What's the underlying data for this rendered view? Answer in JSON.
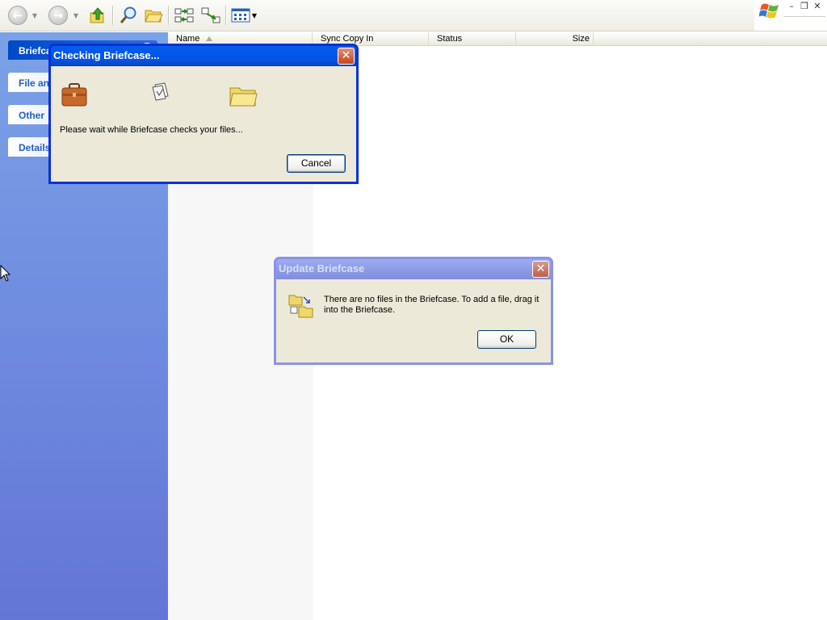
{
  "list": {
    "columns": [
      {
        "label": "Name"
      },
      {
        "label": "Sync Copy In"
      },
      {
        "label": "Status"
      },
      {
        "label": "Size"
      }
    ]
  },
  "tasks": {
    "items": [
      {
        "label": "Briefca",
        "active": true
      },
      {
        "label": "File an",
        "active": false
      },
      {
        "label": "Other",
        "active": false
      },
      {
        "label": "Details",
        "active": false
      }
    ]
  },
  "checking_dialog": {
    "title": "Checking Briefcase...",
    "message": "Please wait while Briefcase checks your files...",
    "cancel_label": "Cancel"
  },
  "update_dialog": {
    "title": "Update Briefcase",
    "message_line1": "There are no files in the Briefcase. To add a file, drag it",
    "message_line2": "into the Briefcase.",
    "ok_label": "OK"
  },
  "toolbar": {
    "icons": [
      "back-icon",
      "forward-icon",
      "up-folder-icon",
      "search-icon",
      "folders-icon",
      "update-all-icon",
      "update-selection-icon",
      "views-icon"
    ]
  },
  "colors": {
    "titlebar_active": "#0058ee",
    "titlebar_inactive": "#8b93e6",
    "dialog_face": "#ece9d8",
    "task_pane_top": "#7ba2e7",
    "task_pane_bottom": "#6375d6"
  }
}
